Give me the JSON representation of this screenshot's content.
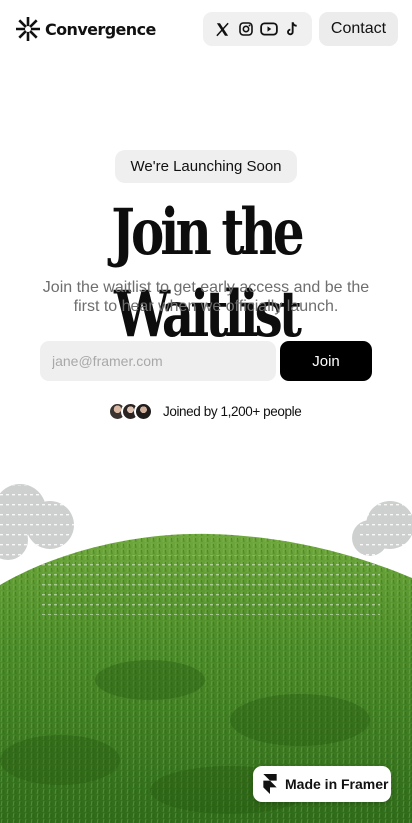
{
  "header": {
    "logo_text": "Convergence",
    "socials": [
      {
        "icon": "x-icon"
      },
      {
        "icon": "instagram-icon"
      },
      {
        "icon": "youtube-icon"
      },
      {
        "icon": "tiktok-icon"
      }
    ],
    "contact_label": "Contact"
  },
  "hero": {
    "badge": "We're Launching Soon",
    "title": "Join the Waitlist",
    "subtitle": "Join the waitlist to get early access and be the first to hear when we officially launch.",
    "email_placeholder": "jane@framer.com",
    "join_label": "Join",
    "joined_text": "Joined by 1,200+ people"
  },
  "footer_badge": {
    "label": "Made in Framer",
    "icon": "framer-icon"
  },
  "colors": {
    "accent": "#000000",
    "grass": "#4a8a2a",
    "surface": "#efefef"
  }
}
